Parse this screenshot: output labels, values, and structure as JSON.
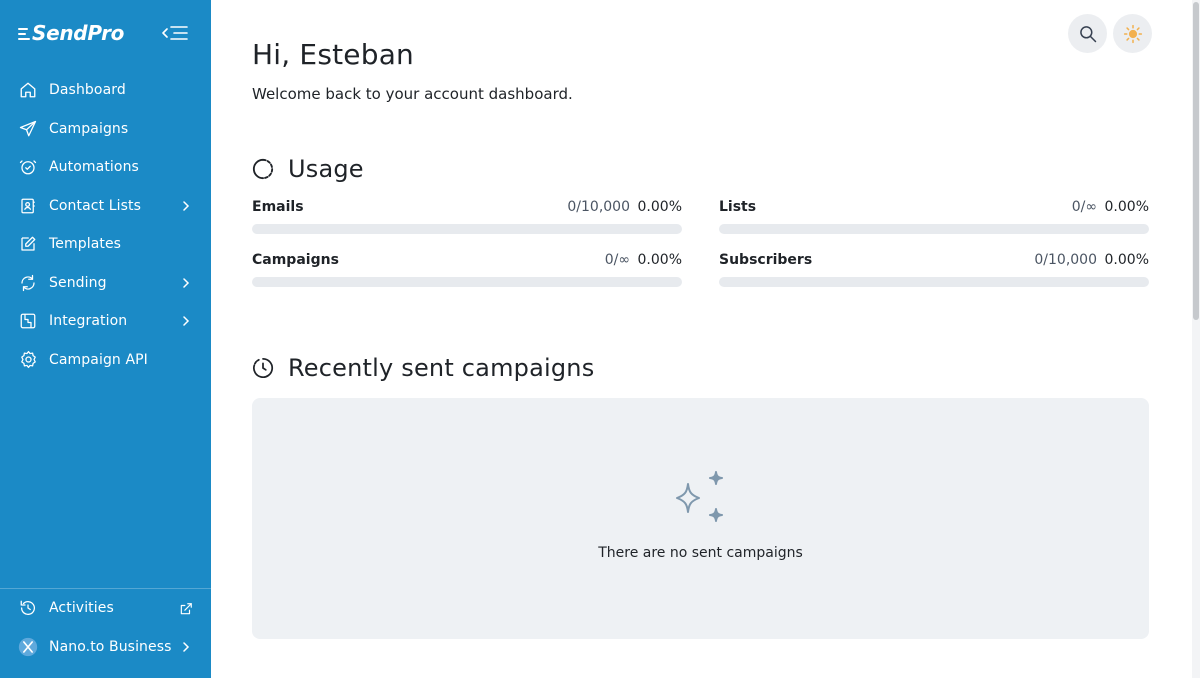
{
  "brand": {
    "name": "SendPro"
  },
  "sidebar": {
    "items": [
      {
        "label": "Dashboard",
        "icon": "home-icon",
        "has_chevron": false
      },
      {
        "label": "Campaigns",
        "icon": "send-icon",
        "has_chevron": false
      },
      {
        "label": "Automations",
        "icon": "alarm-icon",
        "has_chevron": false
      },
      {
        "label": "Contact Lists",
        "icon": "contacts-icon",
        "has_chevron": true
      },
      {
        "label": "Templates",
        "icon": "edit-icon",
        "has_chevron": false
      },
      {
        "label": "Sending",
        "icon": "sync-icon",
        "has_chevron": true
      },
      {
        "label": "Integration",
        "icon": "integration-icon",
        "has_chevron": true
      },
      {
        "label": "Campaign API",
        "icon": "settings-icon",
        "has_chevron": false
      }
    ],
    "bottom": {
      "activities": {
        "label": "Activities"
      },
      "account": {
        "label": "Nano.to Business"
      }
    }
  },
  "main": {
    "greeting": "Hi, Esteban",
    "welcome": "Welcome back to your account dashboard.",
    "usage": {
      "title": "Usage",
      "metrics": [
        {
          "name": "Emails",
          "count": "0/10,000",
          "percent": "0.00%",
          "fill": 0
        },
        {
          "name": "Lists",
          "count": "0/∞",
          "percent": "0.00%",
          "fill": 0
        },
        {
          "name": "Campaigns",
          "count": "0/∞",
          "percent": "0.00%",
          "fill": 0
        },
        {
          "name": "Subscribers",
          "count": "0/10,000",
          "percent": "0.00%",
          "fill": 0
        }
      ]
    },
    "recent": {
      "title": "Recently sent campaigns",
      "empty_text": "There are no sent campaigns"
    }
  },
  "colors": {
    "sidebar": "#1b8ac6",
    "sun_accent": "#f2b04e",
    "empty_icon": "#7f98ad"
  }
}
